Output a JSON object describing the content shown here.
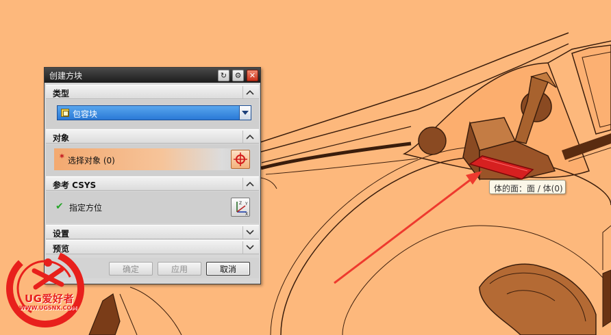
{
  "dialog": {
    "title": "创建方块",
    "sections": {
      "type": {
        "label": "类型",
        "selected_option": "包容块"
      },
      "object": {
        "label": "对象",
        "select_label": "选择对象 (0)"
      },
      "csys": {
        "label": "参考 CSYS",
        "specify_label": "指定方位"
      },
      "settings": {
        "label": "设置"
      },
      "preview": {
        "label": "预览"
      }
    },
    "buttons": {
      "ok": "确定",
      "apply": "应用",
      "cancel": "取消"
    }
  },
  "tooltip": {
    "text": "体的面：面 / 体(0)"
  },
  "watermark": {
    "brand": "UG爱好者",
    "url": "WWW.UGSNX.COM"
  },
  "colors": {
    "viewport_bg": "#fdb87c",
    "model_edge": "#3a1d0c",
    "arrow": "#ee3a2e",
    "highlight_face": "#d62020"
  }
}
